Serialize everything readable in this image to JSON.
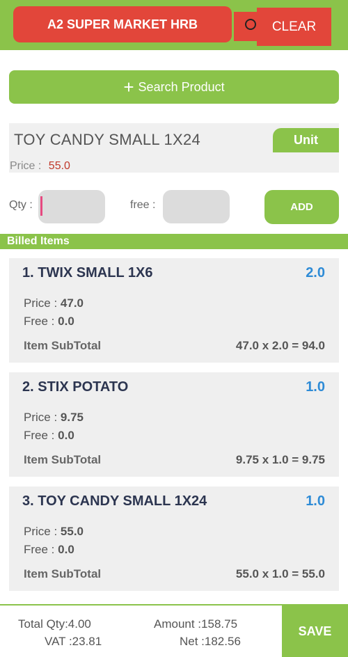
{
  "header": {
    "store_name": "A2 SUPER MARKET HRB",
    "clear_label": "CLEAR"
  },
  "search": {
    "label": "Search Product"
  },
  "product": {
    "name": "TOY CANDY SMALL 1X24",
    "unit_label": "Unit",
    "price_label": "Price :",
    "price_value": "55.0"
  },
  "entry": {
    "qty_label": "Qty :",
    "free_label": "free :",
    "add_label": "ADD"
  },
  "billed": {
    "header": "Billed Items",
    "items": [
      {
        "title": "1. TWIX SMALL 1X6",
        "qty": "2.0",
        "price_label": "Price :",
        "price": "47.0",
        "free_label": "Free :",
        "free": "0.0",
        "subtotal_label": "Item SubTotal",
        "subtotal": "47.0 x 2.0 = 94.0"
      },
      {
        "title": "2. STIX POTATO",
        "qty": "1.0",
        "price_label": "Price :",
        "price": "9.75",
        "free_label": "Free :",
        "free": "0.0",
        "subtotal_label": "Item SubTotal",
        "subtotal": "9.75 x 1.0 = 9.75"
      },
      {
        "title": "3. TOY CANDY SMALL 1X24",
        "qty": "1.0",
        "price_label": "Price :",
        "price": "55.0",
        "free_label": "Free :",
        "free": "0.0",
        "subtotal_label": "Item SubTotal",
        "subtotal": "55.0 x 1.0 = 55.0"
      }
    ]
  },
  "footer": {
    "total_qty": "Total Qty:4.00",
    "vat": "VAT :23.81",
    "amount": "Amount :158.75",
    "net": "Net :182.56",
    "save_label": "SAVE"
  },
  "colors": {
    "accent_green": "#8bc34a",
    "accent_red": "#e2463a",
    "qty_blue": "#2e8bd6"
  },
  "icons": {
    "search": "search-icon",
    "plus": "plus-icon"
  }
}
